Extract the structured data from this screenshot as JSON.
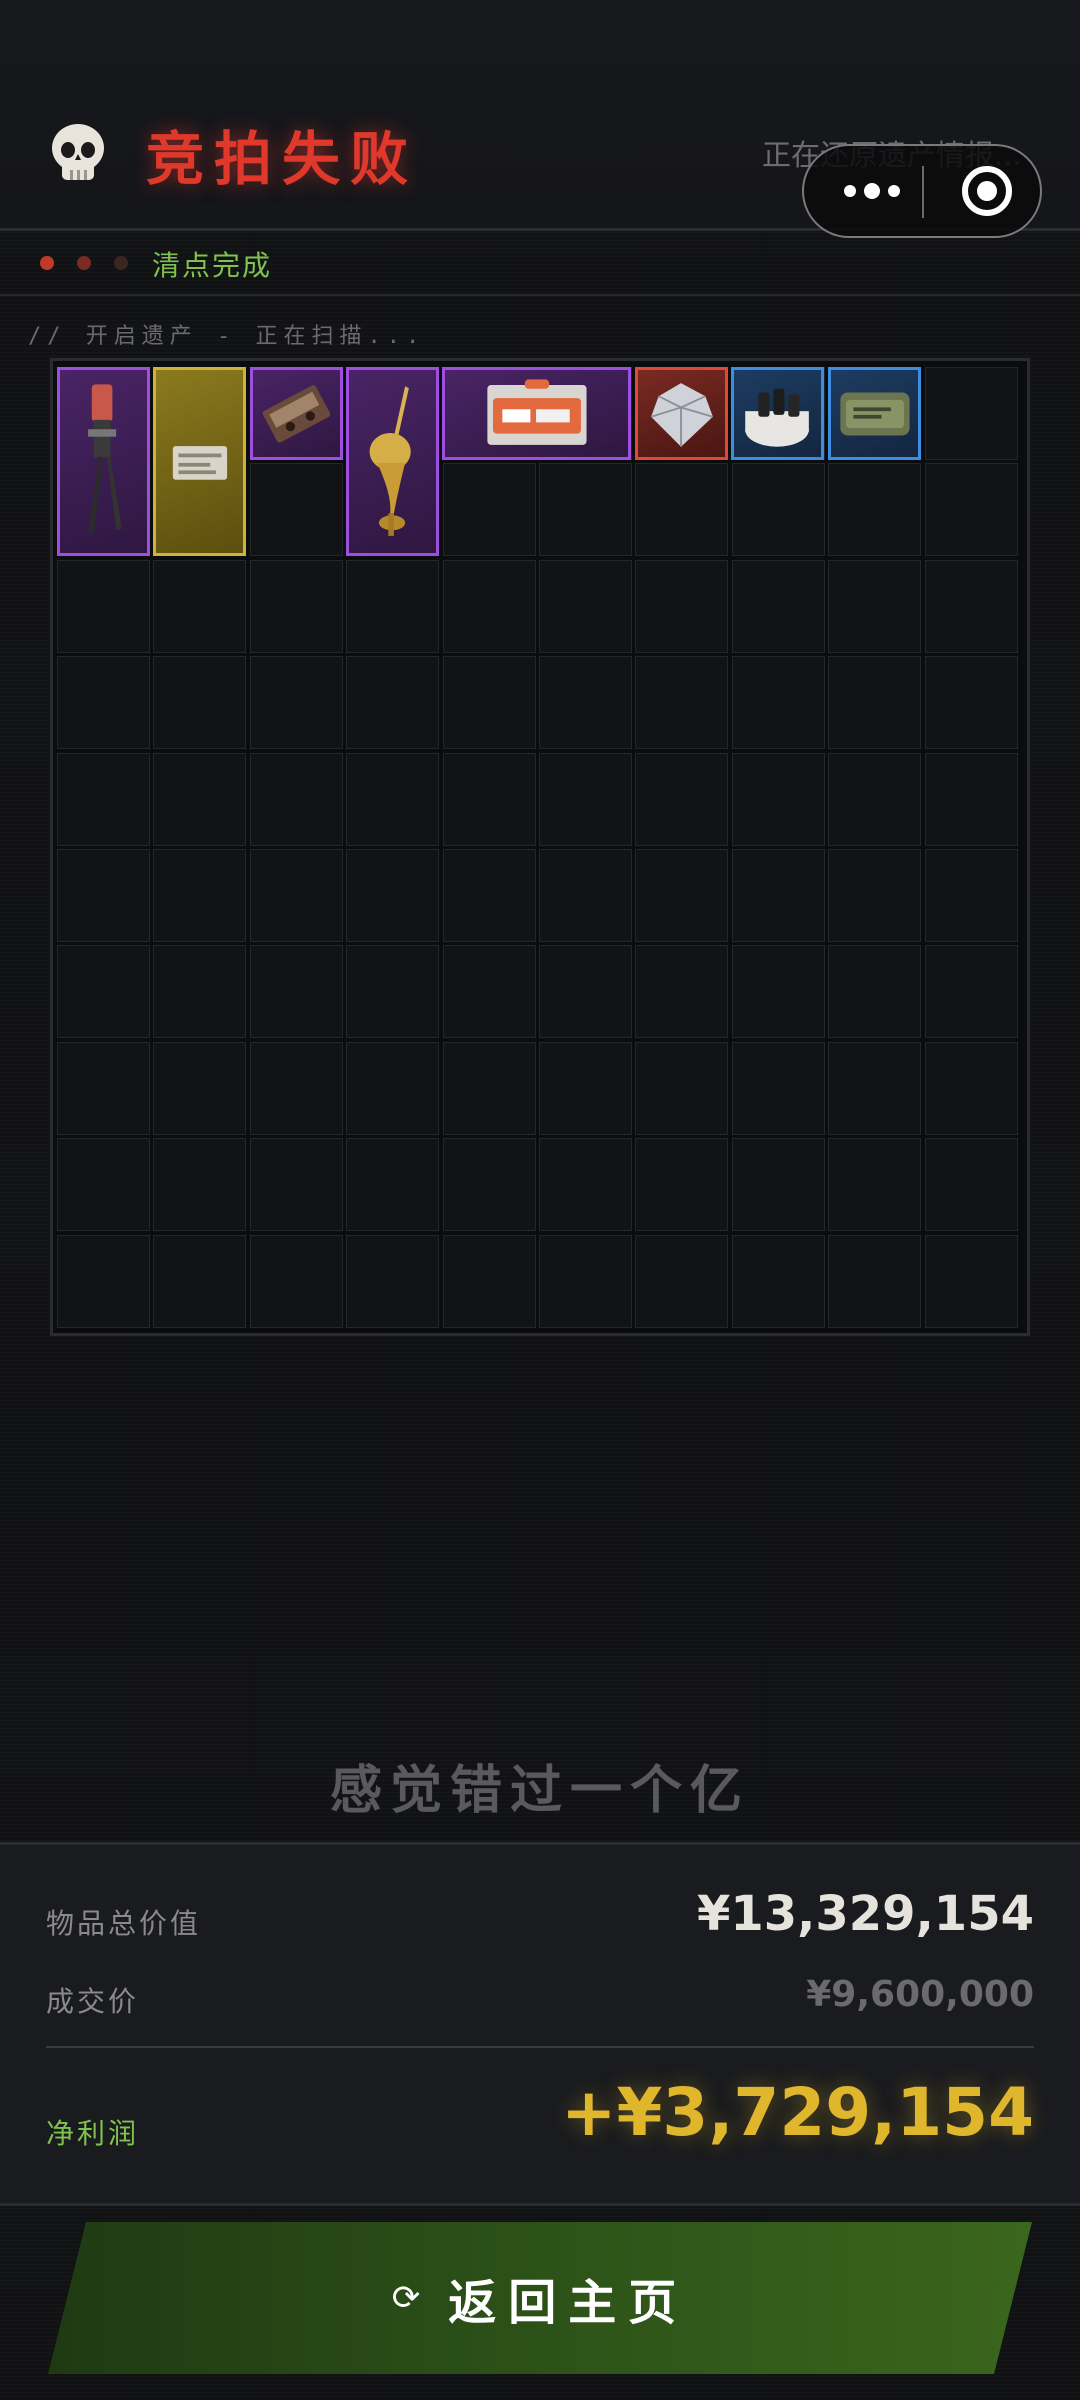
{
  "header": {
    "title": "竞拍失败",
    "restore_text": "正在还原遗产情报...",
    "skull_icon": "skull-icon"
  },
  "status": {
    "text": "清点完成",
    "dots": [
      "#c0392b",
      "#7a2a22",
      "#3a2522"
    ]
  },
  "scan_text": "// 开启遗产 - 正在扫描...",
  "grid": {
    "columns": 10,
    "rows": 10,
    "items": [
      {
        "name": "pipe-wrench-item",
        "rarity": "purple",
        "icon": "pipe-wrench-icon"
      },
      {
        "name": "gold-card-item",
        "rarity": "gold",
        "icon": "card-icon"
      },
      {
        "name": "cassette-tape-item",
        "rarity": "purple",
        "icon": "cassette-icon"
      },
      {
        "name": "golden-statue-item",
        "rarity": "purple",
        "icon": "golden-statue-icon"
      },
      {
        "name": "edc-pack-item",
        "rarity": "purple",
        "icon": "package-icon"
      },
      {
        "name": "diamond-item",
        "rarity": "red",
        "icon": "diamond-icon"
      },
      {
        "name": "bottle-tray-item",
        "rarity": "blue",
        "icon": "bottle-tray-icon"
      },
      {
        "name": "canned-food-item",
        "rarity": "blue",
        "icon": "can-icon"
      }
    ]
  },
  "quip": "感觉错过一个亿",
  "summary": {
    "total_label": "物品总价值",
    "total_value": "¥13,329,154",
    "deal_label": "成交价",
    "deal_value": "¥9,600,000",
    "profit_label": "净利润",
    "profit_value": "+¥3,729,154"
  },
  "return_button": {
    "label": "返回主页",
    "icon": "refresh-icon"
  },
  "capsule": {
    "more_icon": "more-dots-icon",
    "close_icon": "target-icon"
  }
}
